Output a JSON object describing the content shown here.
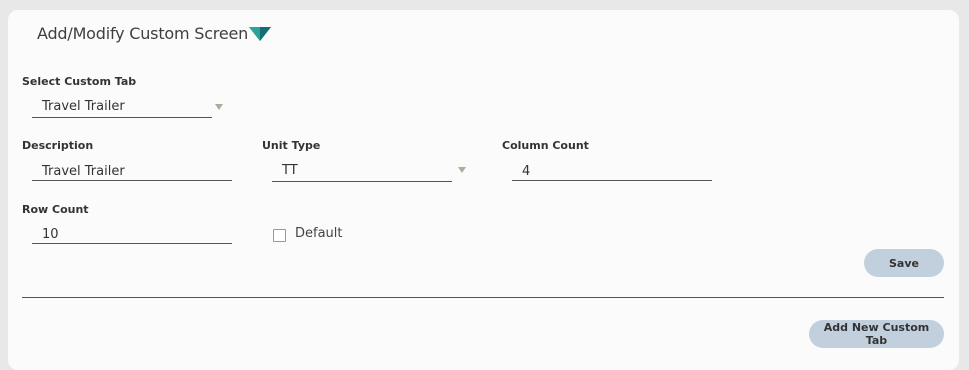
{
  "header": {
    "title": "Add/Modify Custom Screen",
    "icon": "filter-chevron-icon",
    "icon_color": "#1f8a8a"
  },
  "select_custom_tab": {
    "label": "Select Custom Tab",
    "value": "Travel Trailer"
  },
  "description": {
    "label": "Description",
    "value": "Travel Trailer"
  },
  "unit_type": {
    "label": "Unit Type",
    "value": "TT"
  },
  "column_count": {
    "label": "Column Count",
    "value": "4"
  },
  "row_count": {
    "label": "Row Count",
    "value": "10"
  },
  "default_checkbox": {
    "label": "Default",
    "checked": false
  },
  "buttons": {
    "save_label": "Save",
    "add_new_custom_tab_label": "Add New Custom Tab"
  },
  "colors": {
    "button_bg": "#c2d0de",
    "panel_bg": "#fbfbfb",
    "page_bg": "#e8e8e8"
  }
}
